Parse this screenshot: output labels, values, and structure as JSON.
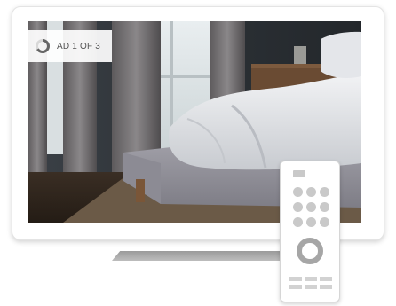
{
  "ad": {
    "label": "AD 1 OF 3",
    "progress_fraction": 0.33
  },
  "icons": {
    "ad_progress": "ring-progress-icon",
    "remote": "tv-remote-icon"
  },
  "colors": {
    "frame": "#ffffff",
    "badge_text": "#555555",
    "remote_keys": "#c9c9c9"
  }
}
